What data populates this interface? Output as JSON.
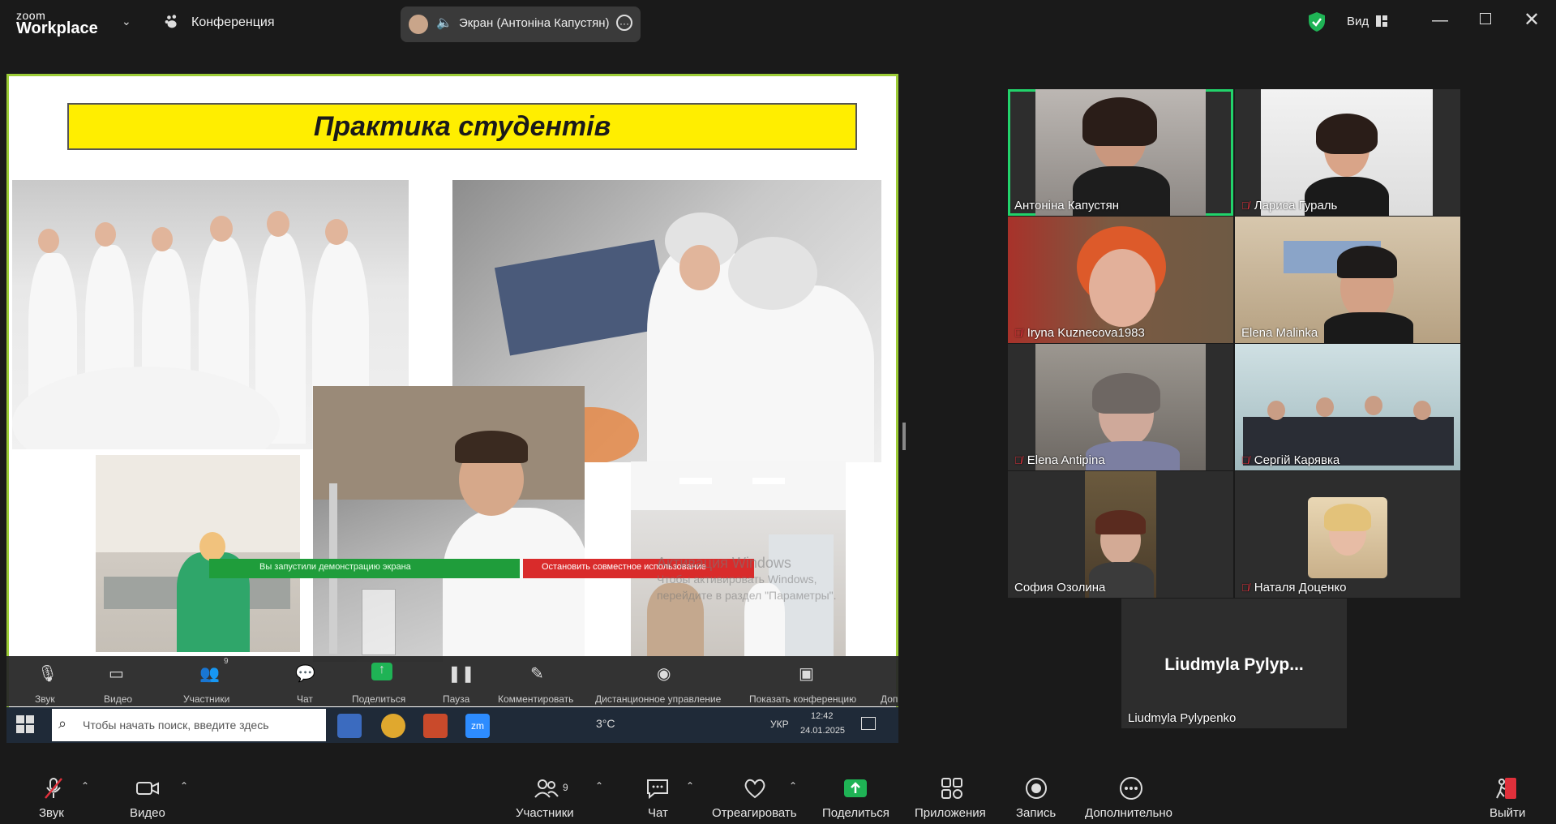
{
  "titlebar": {
    "logo_small": "zoom",
    "logo_big": "Workplace",
    "conference_label": "Конференция",
    "screen_share_label": "Экран (Антоніна Капустян)",
    "view_label": "Вид"
  },
  "slide": {
    "title": "Практика студентів"
  },
  "share_banners": {
    "started": "Вы запустили демонстрацию экрана",
    "stop": "Остановить совместное использование"
  },
  "watermark": {
    "line1": "Активация Windows",
    "line2": "Чтобы активировать Windows,",
    "line3": "перейдите в раздел \"Параметры\"."
  },
  "inner_toolbar": {
    "audio": "Звук",
    "video": "Видео",
    "participants": "Участники",
    "participants_count": "9",
    "chat": "Чат",
    "share": "Поделиться",
    "pause": "Пауза",
    "annotate": "Комментировать",
    "remote": "Дистанционное управление",
    "show_conf": "Показать конференцию",
    "more": "Доп"
  },
  "taskbar": {
    "search_placeholder": "Чтобы начать поиск, введите здесь",
    "weather": "3°C",
    "lang": "УКР",
    "time": "12:42",
    "date": "24.01.2025"
  },
  "participants": [
    {
      "name": "Антоніна Капустян",
      "muted": false,
      "active": true
    },
    {
      "name": "Лариса Гураль",
      "muted": true,
      "active": false
    },
    {
      "name": "Iryna Kuznecova1983",
      "muted": true,
      "active": false
    },
    {
      "name": "Elena Malinka",
      "muted": false,
      "active": false
    },
    {
      "name": "Elena Antipina",
      "muted": true,
      "active": false
    },
    {
      "name": "Сергій Карявка",
      "muted": true,
      "active": false
    },
    {
      "name": "София Озолина",
      "muted": false,
      "active": false
    },
    {
      "name": "Наталя Доценко",
      "muted": true,
      "active": false
    },
    {
      "name": "Liudmyla Pylypenko",
      "muted": false,
      "active": false,
      "avatar_text": "Liudmyla  Pylyp..."
    }
  ],
  "bottom_bar": {
    "audio": "Звук",
    "video": "Видео",
    "participants": "Участники",
    "participants_count": "9",
    "chat": "Чат",
    "react": "Отреагировать",
    "share": "Поделиться",
    "apps": "Приложения",
    "record": "Запись",
    "more": "Дополнительно",
    "leave": "Выйти"
  },
  "colors": {
    "active_speaker": "#22d36b",
    "share_border": "#9ccc37",
    "share_green": "#1f9d3b",
    "mute_red": "#e0303b",
    "slide_title_bg": "#ffee00"
  }
}
